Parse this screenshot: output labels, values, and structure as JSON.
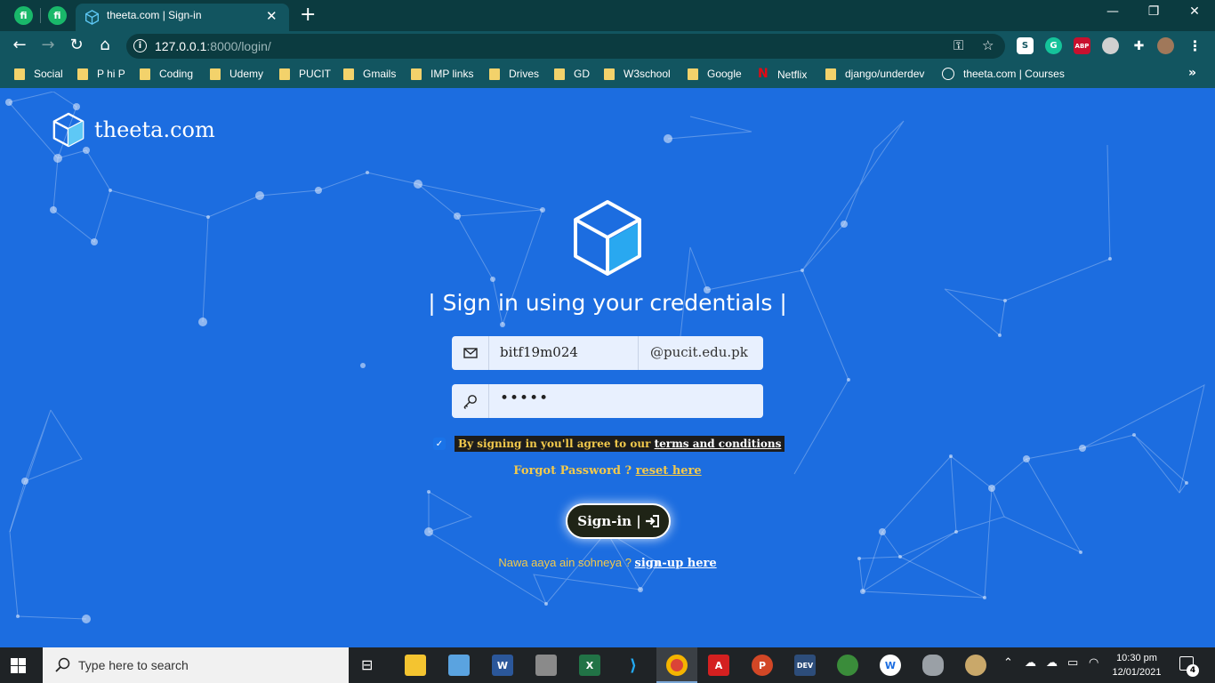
{
  "browser": {
    "tab_title": "theeta.com | Sign-in",
    "pinned_tabs": [
      "fi",
      "fi"
    ],
    "url_host": "127.0.0.1",
    "url_path": ":8000/login/",
    "bookmarks": [
      "Social",
      "P hi P",
      "Coding",
      "Udemy",
      "PUCIT",
      "Gmails",
      "IMP links",
      "Drives",
      "GD",
      "W3school",
      "Google",
      "Netflix",
      "django/underdev",
      "theeta.com | Courses"
    ]
  },
  "page": {
    "brand": "theeta.com",
    "heading": "| Sign in using your credentials |",
    "email_value": "bitf19m024",
    "email_domain": "@pucit.edu.pk",
    "password_value": "•••••",
    "agree_text": "By signing in you'll agree to our ",
    "agree_link": "terms and conditions",
    "forgot_text": "Forgot Password ? ",
    "forgot_link": "reset here",
    "signin_label": "Sign-in |",
    "signup_text": "Nawa aaya ain sohneya ? ",
    "signup_link": "sign-up here"
  },
  "taskbar": {
    "search_placeholder": "Type here to search",
    "time": "10:30 pm",
    "date": "12/01/2021",
    "notifications": "4"
  },
  "colors": {
    "page_bg": "#1c6de0",
    "accent_yellow": "#f2c94c",
    "chrome_dark": "#0b3b40",
    "chrome": "#125560"
  }
}
